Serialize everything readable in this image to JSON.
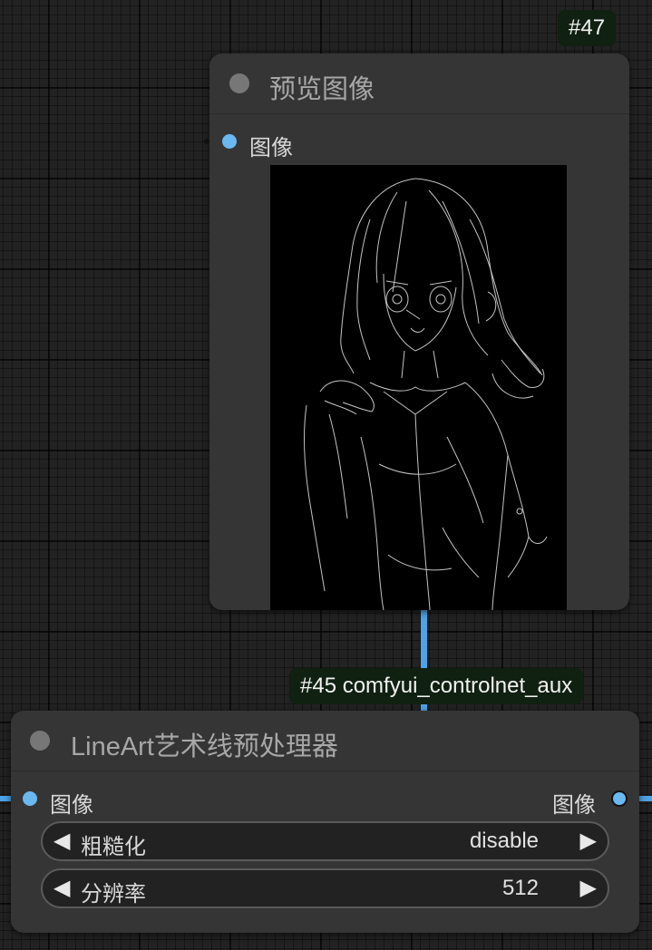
{
  "preview_node": {
    "badge": "#47",
    "title": "预览图像",
    "input_label": "图像",
    "image_alt": "lineart preview"
  },
  "lineart_node": {
    "badge": "#45 comfyui_controlnet_aux",
    "title": "LineArt艺术线预处理器",
    "input_label": "图像",
    "output_label": "图像",
    "widgets": [
      {
        "label": "粗糙化",
        "value": "disable"
      },
      {
        "label": "分辨率",
        "value": "512"
      }
    ]
  },
  "colors": {
    "link": "#4ca3e8",
    "slot": "#6ab8f0",
    "node_bg": "#353535",
    "badge_bg": "#102011"
  },
  "icons": {
    "left_arrow": "◀",
    "right_arrow": "▶"
  }
}
